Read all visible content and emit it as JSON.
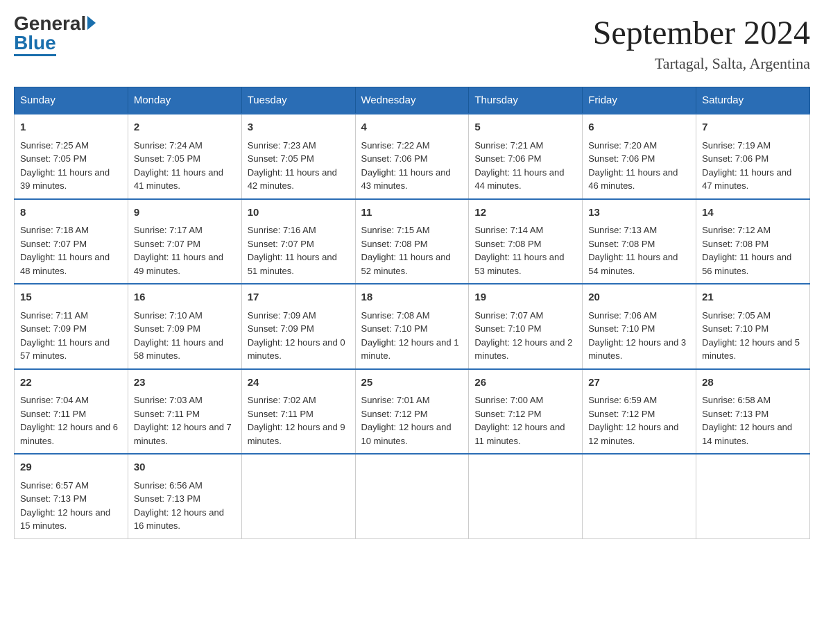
{
  "header": {
    "logo_general": "General",
    "logo_blue": "Blue",
    "month_year": "September 2024",
    "location": "Tartagal, Salta, Argentina"
  },
  "days_of_week": [
    "Sunday",
    "Monday",
    "Tuesday",
    "Wednesday",
    "Thursday",
    "Friday",
    "Saturday"
  ],
  "weeks": [
    [
      {
        "day": "1",
        "sunrise": "7:25 AM",
        "sunset": "7:05 PM",
        "daylight": "11 hours and 39 minutes."
      },
      {
        "day": "2",
        "sunrise": "7:24 AM",
        "sunset": "7:05 PM",
        "daylight": "11 hours and 41 minutes."
      },
      {
        "day": "3",
        "sunrise": "7:23 AM",
        "sunset": "7:05 PM",
        "daylight": "11 hours and 42 minutes."
      },
      {
        "day": "4",
        "sunrise": "7:22 AM",
        "sunset": "7:06 PM",
        "daylight": "11 hours and 43 minutes."
      },
      {
        "day": "5",
        "sunrise": "7:21 AM",
        "sunset": "7:06 PM",
        "daylight": "11 hours and 44 minutes."
      },
      {
        "day": "6",
        "sunrise": "7:20 AM",
        "sunset": "7:06 PM",
        "daylight": "11 hours and 46 minutes."
      },
      {
        "day": "7",
        "sunrise": "7:19 AM",
        "sunset": "7:06 PM",
        "daylight": "11 hours and 47 minutes."
      }
    ],
    [
      {
        "day": "8",
        "sunrise": "7:18 AM",
        "sunset": "7:07 PM",
        "daylight": "11 hours and 48 minutes."
      },
      {
        "day": "9",
        "sunrise": "7:17 AM",
        "sunset": "7:07 PM",
        "daylight": "11 hours and 49 minutes."
      },
      {
        "day": "10",
        "sunrise": "7:16 AM",
        "sunset": "7:07 PM",
        "daylight": "11 hours and 51 minutes."
      },
      {
        "day": "11",
        "sunrise": "7:15 AM",
        "sunset": "7:08 PM",
        "daylight": "11 hours and 52 minutes."
      },
      {
        "day": "12",
        "sunrise": "7:14 AM",
        "sunset": "7:08 PM",
        "daylight": "11 hours and 53 minutes."
      },
      {
        "day": "13",
        "sunrise": "7:13 AM",
        "sunset": "7:08 PM",
        "daylight": "11 hours and 54 minutes."
      },
      {
        "day": "14",
        "sunrise": "7:12 AM",
        "sunset": "7:08 PM",
        "daylight": "11 hours and 56 minutes."
      }
    ],
    [
      {
        "day": "15",
        "sunrise": "7:11 AM",
        "sunset": "7:09 PM",
        "daylight": "11 hours and 57 minutes."
      },
      {
        "day": "16",
        "sunrise": "7:10 AM",
        "sunset": "7:09 PM",
        "daylight": "11 hours and 58 minutes."
      },
      {
        "day": "17",
        "sunrise": "7:09 AM",
        "sunset": "7:09 PM",
        "daylight": "12 hours and 0 minutes."
      },
      {
        "day": "18",
        "sunrise": "7:08 AM",
        "sunset": "7:10 PM",
        "daylight": "12 hours and 1 minute."
      },
      {
        "day": "19",
        "sunrise": "7:07 AM",
        "sunset": "7:10 PM",
        "daylight": "12 hours and 2 minutes."
      },
      {
        "day": "20",
        "sunrise": "7:06 AM",
        "sunset": "7:10 PM",
        "daylight": "12 hours and 3 minutes."
      },
      {
        "day": "21",
        "sunrise": "7:05 AM",
        "sunset": "7:10 PM",
        "daylight": "12 hours and 5 minutes."
      }
    ],
    [
      {
        "day": "22",
        "sunrise": "7:04 AM",
        "sunset": "7:11 PM",
        "daylight": "12 hours and 6 minutes."
      },
      {
        "day": "23",
        "sunrise": "7:03 AM",
        "sunset": "7:11 PM",
        "daylight": "12 hours and 7 minutes."
      },
      {
        "day": "24",
        "sunrise": "7:02 AM",
        "sunset": "7:11 PM",
        "daylight": "12 hours and 9 minutes."
      },
      {
        "day": "25",
        "sunrise": "7:01 AM",
        "sunset": "7:12 PM",
        "daylight": "12 hours and 10 minutes."
      },
      {
        "day": "26",
        "sunrise": "7:00 AM",
        "sunset": "7:12 PM",
        "daylight": "12 hours and 11 minutes."
      },
      {
        "day": "27",
        "sunrise": "6:59 AM",
        "sunset": "7:12 PM",
        "daylight": "12 hours and 12 minutes."
      },
      {
        "day": "28",
        "sunrise": "6:58 AM",
        "sunset": "7:13 PM",
        "daylight": "12 hours and 14 minutes."
      }
    ],
    [
      {
        "day": "29",
        "sunrise": "6:57 AM",
        "sunset": "7:13 PM",
        "daylight": "12 hours and 15 minutes."
      },
      {
        "day": "30",
        "sunrise": "6:56 AM",
        "sunset": "7:13 PM",
        "daylight": "12 hours and 16 minutes."
      },
      null,
      null,
      null,
      null,
      null
    ]
  ],
  "labels": {
    "sunrise": "Sunrise:",
    "sunset": "Sunset:",
    "daylight": "Daylight:"
  }
}
